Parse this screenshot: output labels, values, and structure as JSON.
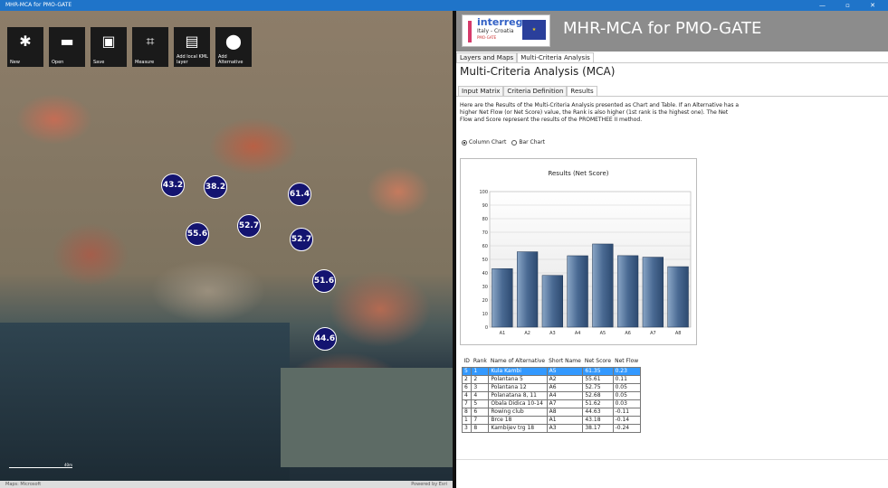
{
  "window": {
    "title": "MHR-MCA for PMO-GATE",
    "controls": "— ▫ ✕"
  },
  "toolbar": [
    {
      "label": "New",
      "icon": "new-icon",
      "glyph": "✱"
    },
    {
      "label": "Open",
      "icon": "folder-icon",
      "glyph": "▬"
    },
    {
      "label": "Save",
      "icon": "save-icon",
      "glyph": "▣"
    },
    {
      "label": "Measure",
      "icon": "crop-icon",
      "glyph": "⌗"
    },
    {
      "label": "Add local KML layer",
      "icon": "add-layer-icon",
      "glyph": "▤"
    },
    {
      "label": "Add Alternative",
      "icon": "map-pin-icon",
      "glyph": "⬤"
    }
  ],
  "markers": [
    {
      "value": "43.2"
    },
    {
      "value": "38.2"
    },
    {
      "value": "61.4"
    },
    {
      "value": "55.6"
    },
    {
      "value": "52.7"
    },
    {
      "value": "52.7"
    },
    {
      "value": "51.6"
    },
    {
      "value": "44.6"
    }
  ],
  "map": {
    "attribution_left": "Maps: Microsoft",
    "attribution_right": "Powered by Esri",
    "scale_top": "40m",
    "scale_bottom": "100ft"
  },
  "panel": {
    "logo": {
      "line1": "interreg",
      "line2": "Italy - Croatia",
      "line3": "PMO-GATE",
      "flag": "EUROPEAN UNION"
    },
    "app_title": "MHR-MCA for PMO-GATE",
    "tabs": [
      "Layers and Maps",
      "Multi-Criteria Analysis"
    ],
    "section_title": "Multi-Criteria Analysis (MCA)",
    "subtabs": [
      "Input Matrix",
      "Criteria Definition",
      "Results"
    ],
    "description": "Here are the Results of the Multi-Criteria Analysis presented as Chart and Table. If an Alternative has a higher Net Flow (or Net Score) value, the Rank is also higher (1st rank is the highest one). The Net Flow and Score represent the results of the PROMETHEE II method.",
    "radio_column": "Column Chart",
    "radio_bar": "Bar Chart"
  },
  "chart_data": {
    "type": "bar",
    "title": "Results (Net Score)",
    "categories": [
      "A1",
      "A2",
      "A3",
      "A4",
      "A5",
      "A6",
      "A7",
      "A8"
    ],
    "values": [
      43.18,
      55.61,
      38.17,
      52.68,
      61.35,
      52.75,
      51.62,
      44.63
    ],
    "ylim": [
      0,
      100
    ],
    "yticks": [
      0,
      10,
      20,
      30,
      40,
      50,
      60,
      70,
      80,
      90,
      100
    ],
    "grid": true,
    "color": "#4a6a93"
  },
  "results_table": {
    "headers": [
      "ID",
      "Rank",
      "Name of Alternative",
      "Short Name",
      "Net Score",
      "Net Flow"
    ],
    "rows": [
      [
        "5",
        "1",
        "Kula Kambi",
        "A5",
        "61.35",
        "0.23"
      ],
      [
        "2",
        "2",
        "Polantana 5",
        "A2",
        "55.61",
        "0.11"
      ],
      [
        "6",
        "3",
        "Polantana 12",
        "A6",
        "52.75",
        "0.05"
      ],
      [
        "4",
        "4",
        "Polanatana 8, 11",
        "A4",
        "52.68",
        "0.05"
      ],
      [
        "7",
        "5",
        "Obala Didica 10-14",
        "A7",
        "51.62",
        "0.03"
      ],
      [
        "8",
        "6",
        "Rowing club",
        "A8",
        "44.63",
        "-0.11"
      ],
      [
        "1",
        "7",
        "Brce 18",
        "A1",
        "43.18",
        "-0.14"
      ],
      [
        "3",
        "8",
        "Kambijev trg 18",
        "A3",
        "38.17",
        "-0.24"
      ]
    ],
    "selected_row": 0
  }
}
